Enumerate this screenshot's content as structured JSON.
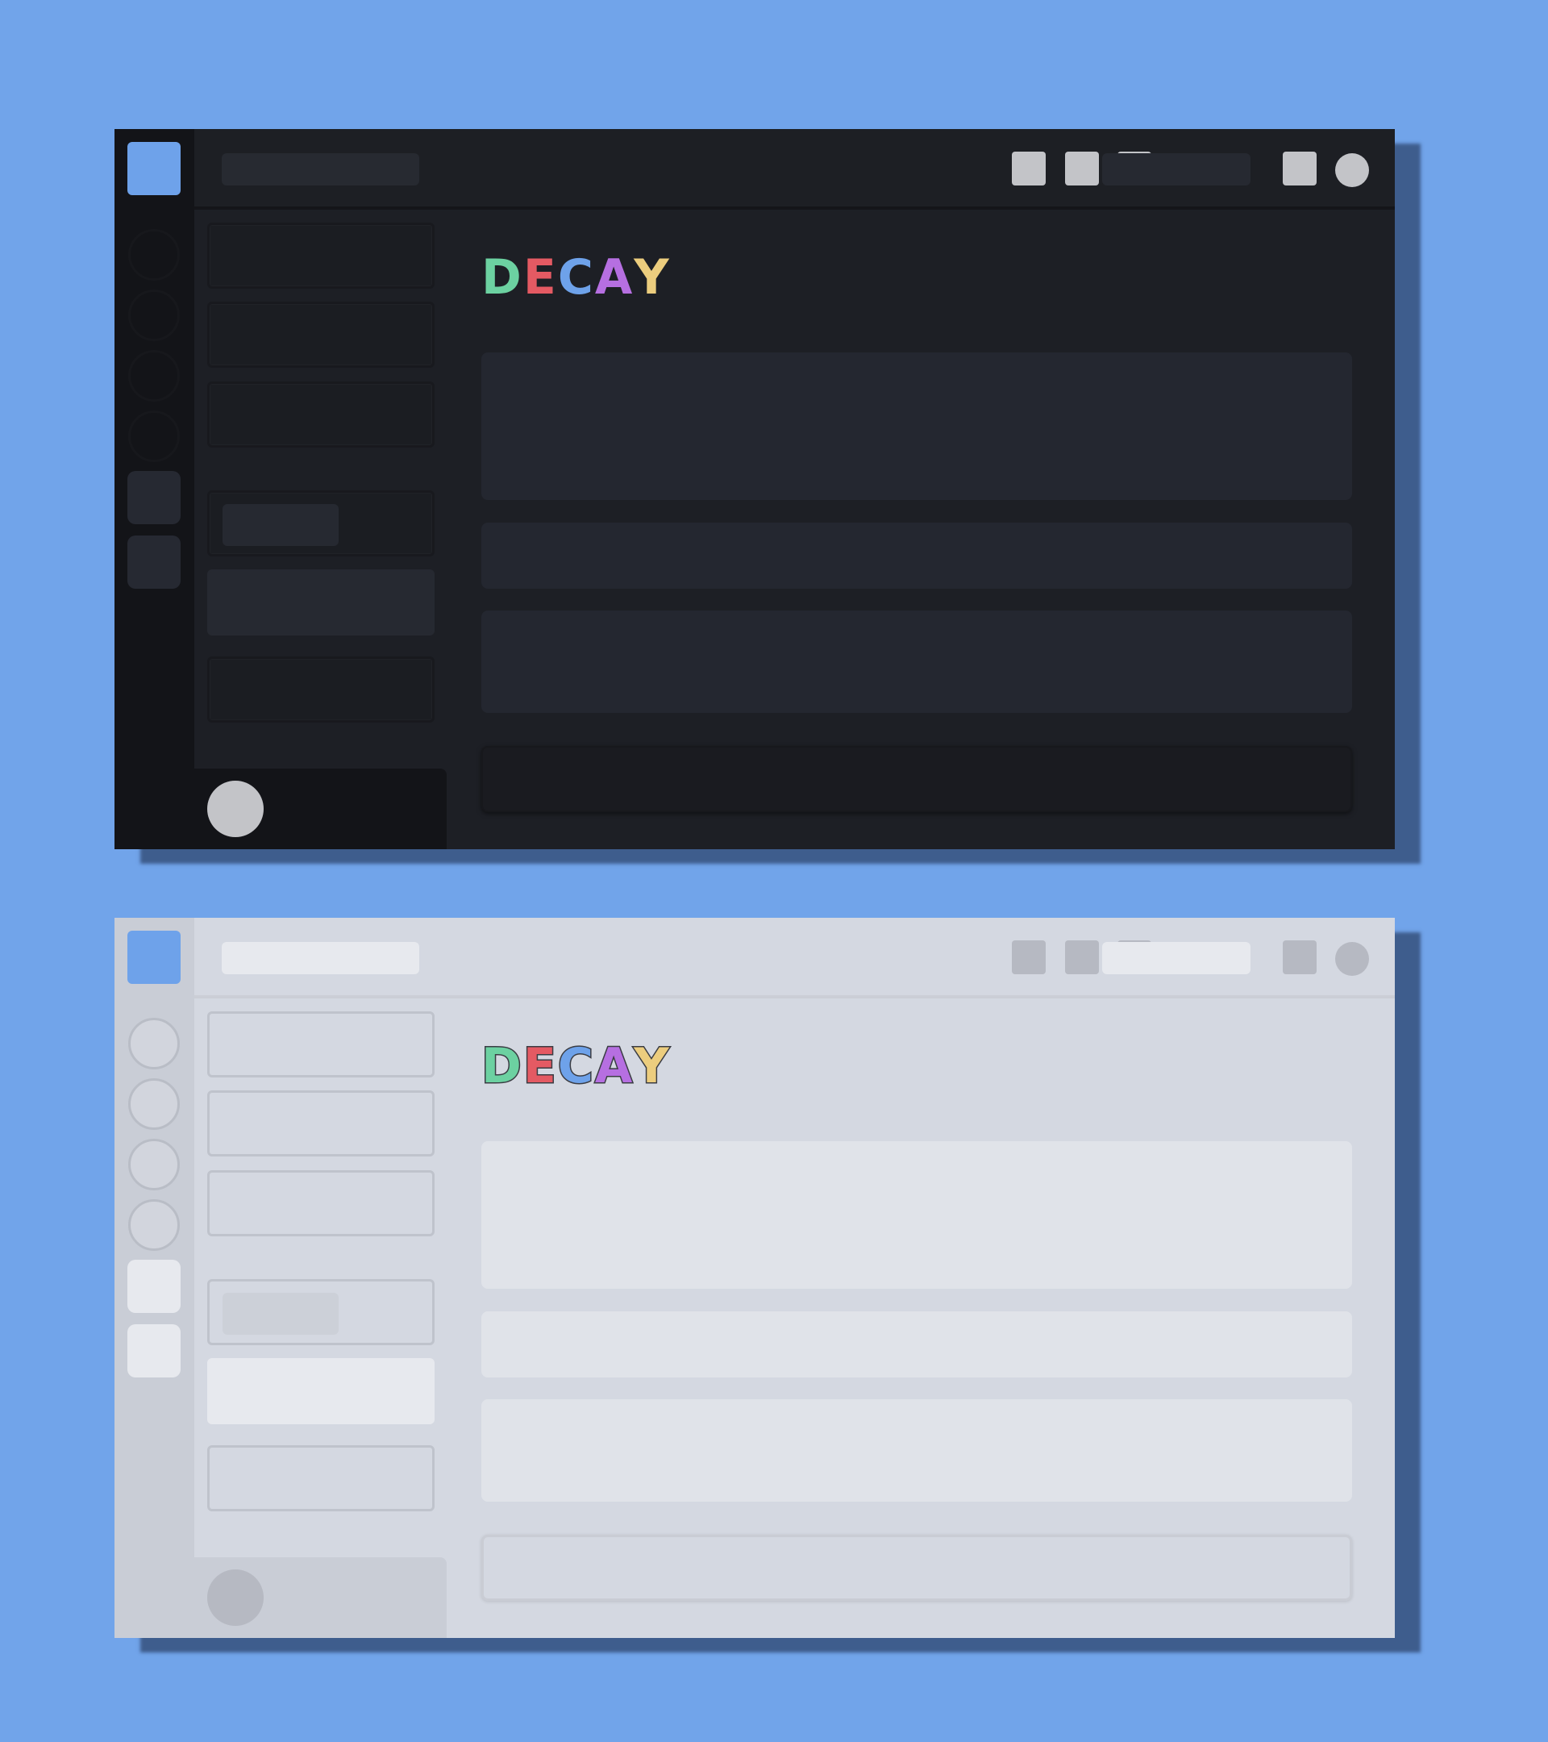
{
  "brand": {
    "letters": [
      {
        "char": "D",
        "color": "#6cd1a1"
      },
      {
        "char": "E",
        "color": "#e45a63"
      },
      {
        "char": "C",
        "color": "#6ea2ea"
      },
      {
        "char": "A",
        "color": "#b66fe1"
      },
      {
        "char": "Y",
        "color": "#eccd7e"
      }
    ]
  },
  "themes": [
    {
      "name": "dark",
      "background": "#1d1f25",
      "accent": "#6ea2ea"
    },
    {
      "name": "light",
      "background": "#d4d8e1",
      "accent": "#6ea2ea"
    }
  ],
  "icons": {
    "app": "app-logo-icon",
    "toolbar": [
      "toolbar-icon-1",
      "toolbar-icon-2",
      "toolbar-icon-3",
      "inbox-icon"
    ],
    "user": "user-avatar-icon"
  },
  "page_background": "#71a4ea"
}
